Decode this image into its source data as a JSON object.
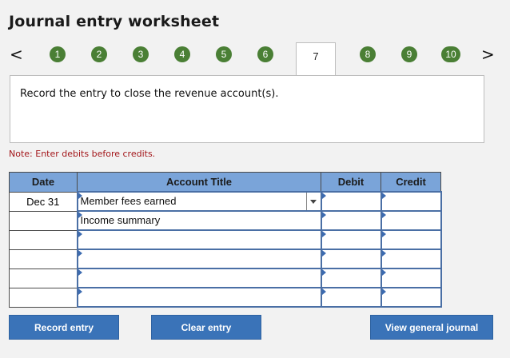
{
  "title": "Journal entry worksheet",
  "nav": {
    "prev_label": "<",
    "next_label": ">",
    "steps": [
      "1",
      "2",
      "3",
      "4",
      "5",
      "6",
      "7",
      "8",
      "9",
      "10"
    ],
    "active_step": "7"
  },
  "instruction": "Record the entry to close the revenue account(s).",
  "note": "Note: Enter debits before credits.",
  "table": {
    "headers": {
      "date": "Date",
      "account": "Account Title",
      "debit": "Debit",
      "credit": "Credit"
    },
    "rows": [
      {
        "date": "Dec 31",
        "account": "Member fees earned",
        "debit": "",
        "credit": ""
      },
      {
        "date": "",
        "account": "Income summary",
        "debit": "",
        "credit": ""
      },
      {
        "date": "",
        "account": "",
        "debit": "",
        "credit": ""
      },
      {
        "date": "",
        "account": "",
        "debit": "",
        "credit": ""
      },
      {
        "date": "",
        "account": "",
        "debit": "",
        "credit": ""
      },
      {
        "date": "",
        "account": "",
        "debit": "",
        "credit": ""
      }
    ]
  },
  "buttons": {
    "record": "Record entry",
    "clear": "Clear entry",
    "view": "View general journal"
  },
  "colors": {
    "step_green": "#4a7f35",
    "header_blue": "#7aa4d9",
    "button_blue": "#3a73b8",
    "note_red": "#a3161a"
  }
}
